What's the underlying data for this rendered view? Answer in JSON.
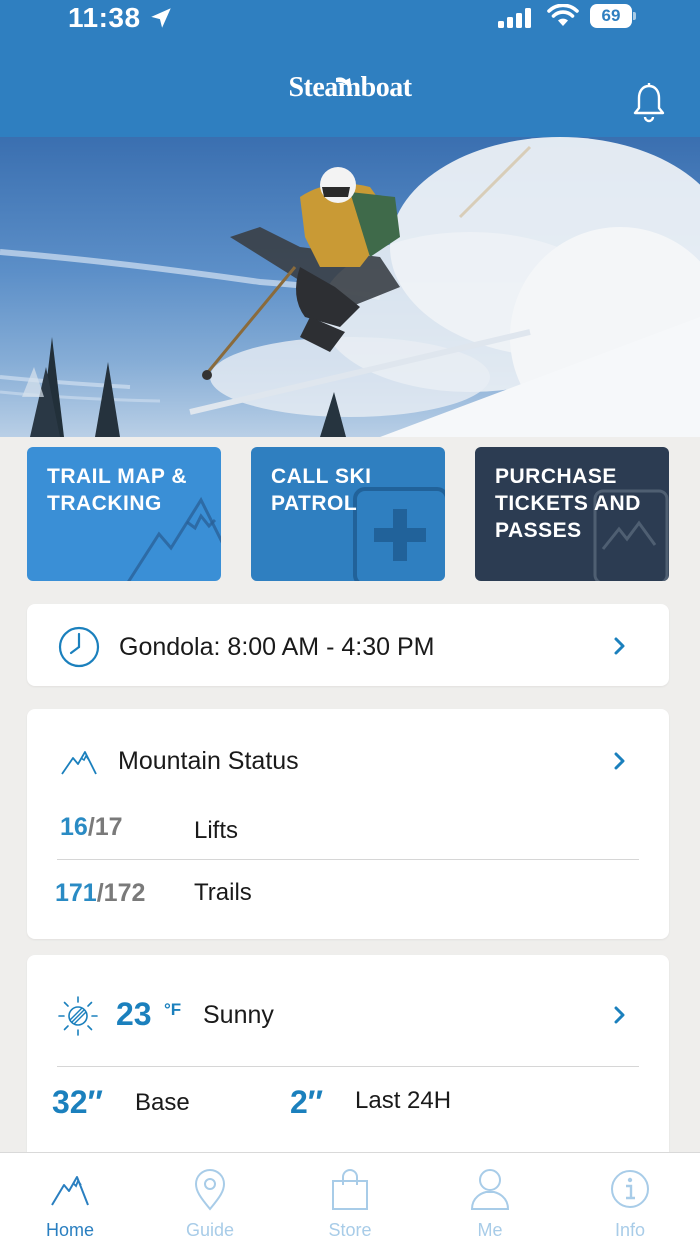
{
  "status_bar": {
    "time": "11:38",
    "battery": "69"
  },
  "header": {
    "logo_text": "Steamboat"
  },
  "tiles": [
    {
      "label": "TRAIL MAP & TRACKING"
    },
    {
      "label": "CALL SKI PATROL"
    },
    {
      "label": "PURCHASE TICKETS AND PASSES"
    }
  ],
  "gondola": {
    "text": "Gondola: 8:00 AM - 4:30 PM"
  },
  "mountain_status": {
    "title": "Mountain Status",
    "lifts": {
      "open": "16",
      "total": "/17",
      "label": "Lifts"
    },
    "trails": {
      "open": "171",
      "total": "/172",
      "label": "Trails"
    }
  },
  "weather": {
    "temperature": "23",
    "unit": "°F",
    "condition": "Sunny",
    "base": {
      "value": "32″",
      "label": "Base"
    },
    "last24": {
      "value": "2″",
      "label": "Last 24H"
    }
  },
  "tabs": [
    {
      "label": "Home",
      "icon": "mountain-icon",
      "active": true
    },
    {
      "label": "Guide",
      "icon": "map-pin-icon",
      "active": false
    },
    {
      "label": "Store",
      "icon": "shopping-bag-icon",
      "active": false
    },
    {
      "label": "Me",
      "icon": "person-icon",
      "active": false
    },
    {
      "label": "Info",
      "icon": "info-icon",
      "active": false
    }
  ],
  "colors": {
    "header": "#2f7fc0",
    "accent": "#1b80bd",
    "tile_trail": "#3a8fd6",
    "tile_patrol": "#2f7fc0",
    "tile_tickets": "#2c3c52",
    "tab_inactive": "#a8cce8"
  }
}
